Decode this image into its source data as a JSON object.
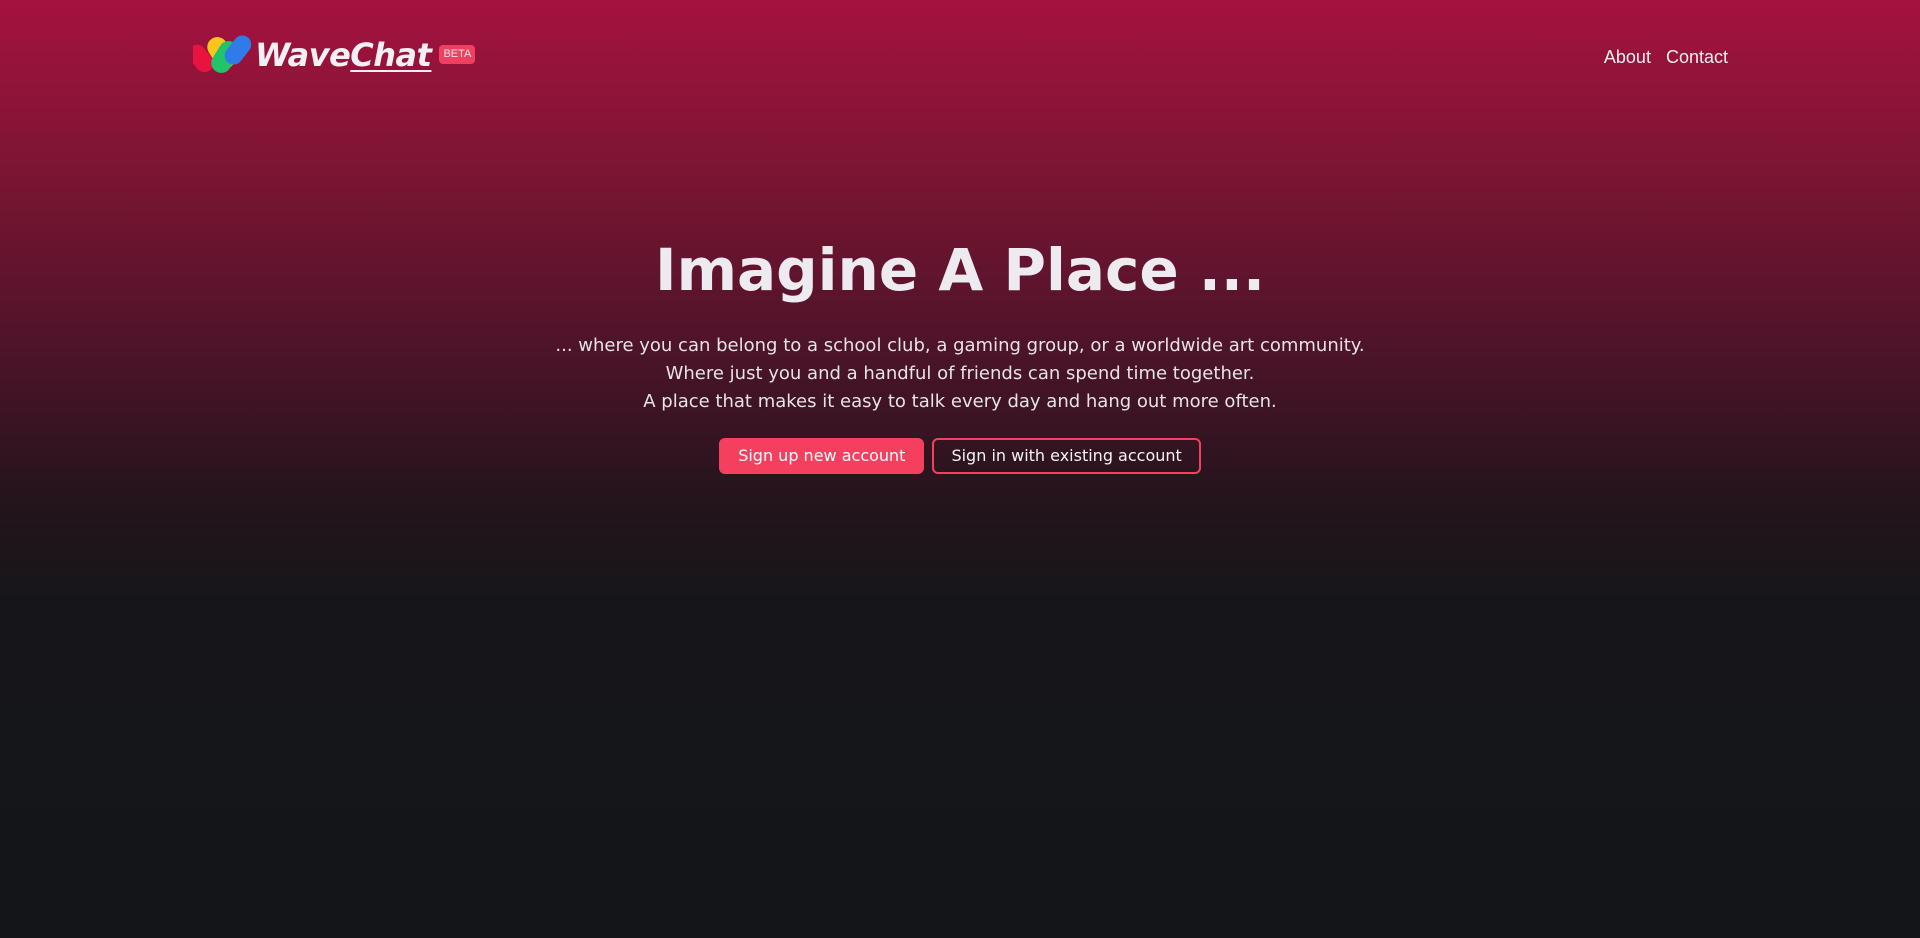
{
  "brand": {
    "name_part1": "Wave",
    "name_part2": "Chat",
    "badge": "BETA",
    "logo_icon": "wavechat-logo-icon"
  },
  "nav": {
    "links": [
      {
        "label": "About"
      },
      {
        "label": "Contact"
      }
    ]
  },
  "hero": {
    "title": "Imagine A Place ...",
    "lines": [
      "... where you can belong to a school club, a gaming group, or a worldwide art community.",
      "Where just you and a handful of friends can spend time together.",
      "A place that makes it easy to talk every day and hang out more often."
    ],
    "primary_button": "Sign up new account",
    "secondary_button": "Sign in with existing account"
  },
  "colors": {
    "accent": "#f43f5e",
    "header_gradient_top": "#a5123f",
    "background": "#141519"
  }
}
